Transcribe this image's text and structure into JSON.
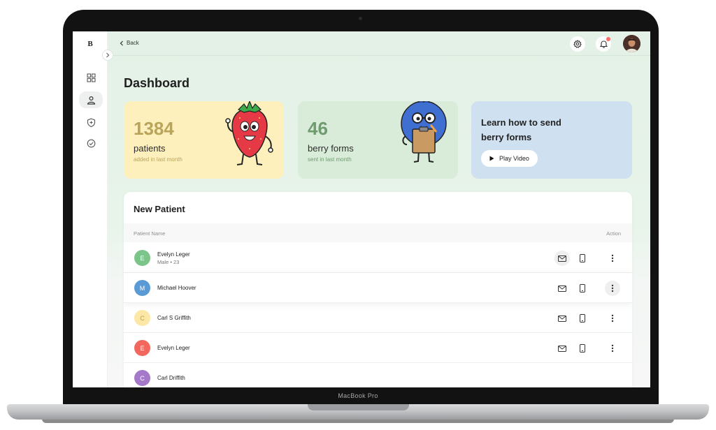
{
  "device": {
    "brand_label": "MacBook Pro"
  },
  "app": {
    "logo": "B"
  },
  "sidebar": {
    "items": [
      {
        "icon": "grid-icon",
        "active": false
      },
      {
        "icon": "user-icon",
        "active": true
      },
      {
        "icon": "shield-icon",
        "active": false
      },
      {
        "icon": "check-circle-icon",
        "active": false
      }
    ]
  },
  "topbar": {
    "back_label": "Back",
    "icons": [
      "gear-icon",
      "bell-icon",
      "avatar"
    ]
  },
  "page": {
    "title": "Dashboard"
  },
  "cards": {
    "patients": {
      "number": "1384",
      "label": "patients",
      "sub": "added in last month",
      "bg": "#fdf0bd",
      "num_color": "#b9a45a"
    },
    "forms": {
      "number": "46",
      "label": "berry forms",
      "sub": "sent in last month",
      "bg": "#d8ecd9",
      "num_color": "#6f9b6f"
    },
    "learn": {
      "title": "Learn how to send berry forms",
      "play_label": "Play Video",
      "bg": "#cfe0f0"
    }
  },
  "table": {
    "title": "New Patient",
    "columns": [
      "Patient Name",
      "Action"
    ],
    "rows": [
      {
        "initial": "E",
        "name": "Evelyn Leger",
        "meta": "Male • 23",
        "color": "#7bc58b"
      },
      {
        "initial": "M",
        "name": "Michael Hoover",
        "meta": "",
        "color": "#5b9bd5"
      },
      {
        "initial": "C",
        "name": "Carl S Griffith",
        "meta": "",
        "color": "#fde7a6",
        "text_color": "#c6a13a"
      },
      {
        "initial": "E",
        "name": "Evelyn Leger",
        "meta": "",
        "color": "#f2685f"
      },
      {
        "initial": "C",
        "name": "Carl Driffith",
        "meta": "",
        "color": "#a479c9"
      }
    ]
  }
}
